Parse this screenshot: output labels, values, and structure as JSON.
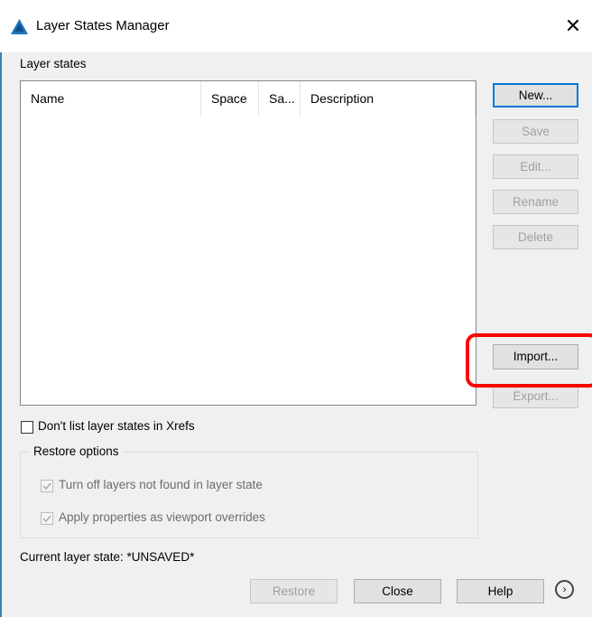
{
  "window": {
    "title": "Layer States Manager",
    "close_glyph": "✕",
    "app_icon": "autocad-logo-icon"
  },
  "list": {
    "label": "Layer states",
    "columns": [
      "Name",
      "Space",
      "Sa...",
      "Description"
    ]
  },
  "side_buttons": {
    "new": "New...",
    "save": "Save",
    "edit": "Edit...",
    "rename": "Rename",
    "delete": "Delete",
    "import": "Import...",
    "export": "Export..."
  },
  "xrefs_option": {
    "label": "Don't list layer states in Xrefs",
    "checked": false
  },
  "restore_options": {
    "title": "Restore options",
    "turn_off": {
      "label": "Turn off layers not found in layer state",
      "checked": true,
      "enabled": false
    },
    "apply_props": {
      "label": "Apply properties as viewport overrides",
      "checked": true,
      "enabled": false
    }
  },
  "status": {
    "current_state": "Current layer state: *UNSAVED*"
  },
  "footer_buttons": {
    "restore": "Restore",
    "close": "Close",
    "help": "Help",
    "more_glyph": "›"
  },
  "colors": {
    "highlight": "#ff0000",
    "accent": "#0078d7"
  }
}
